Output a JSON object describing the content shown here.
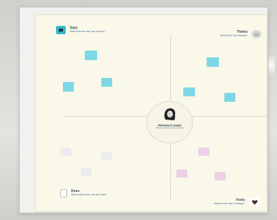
{
  "board": {
    "says": {
      "title": "Says",
      "question": "What does the user say out loud?"
    },
    "thinks": {
      "title": "Thinks",
      "question": "What is the user thinking?"
    },
    "does": {
      "title": "Does",
      "question": "What actions does the user take?"
    },
    "feels": {
      "title": "Feels",
      "question": "What are the user's feelings?"
    }
  },
  "persona": {
    "name": "Persona's name",
    "description": "Short summary of the persona"
  },
  "notes": {
    "says": [
      "",
      "",
      ""
    ],
    "thinks": [
      "",
      "",
      ""
    ],
    "does": [
      "",
      "",
      ""
    ],
    "feels": [
      "",
      "",
      ""
    ]
  },
  "footer": {
    "label": ""
  },
  "colors": {
    "accent": "#2db9c9",
    "board": "#faf8e8",
    "note_cyan": "#7ed7e6",
    "note_pink": "#eccfe9",
    "note_grey": "#ececec"
  },
  "icons": {
    "says": "speech-bubble-icon",
    "thinks": "thought-cloud-icon",
    "does": "clipboard-icon",
    "feels": "heart-icon",
    "avatar": "person-avatar-icon"
  }
}
